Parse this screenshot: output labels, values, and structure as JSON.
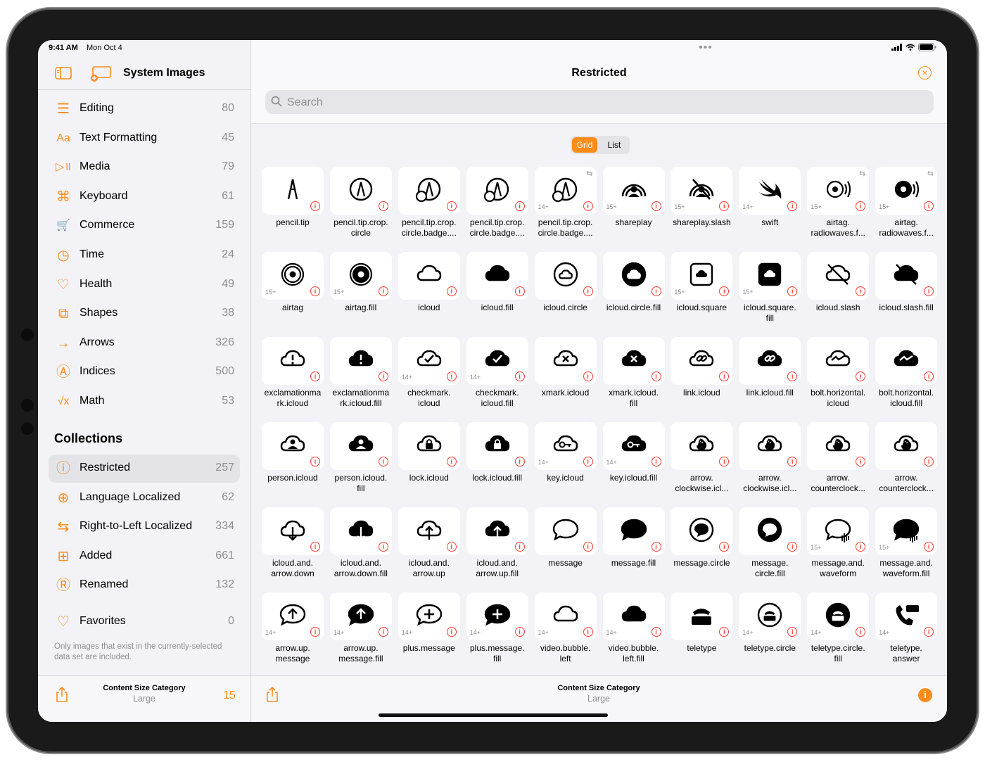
{
  "status": {
    "time": "9:41 AM",
    "date": "Mon Oct 4"
  },
  "sidebar": {
    "title": "System Images",
    "categories": [
      {
        "label": "Editing",
        "count": "80",
        "icon": "sliders-icon"
      },
      {
        "label": "Text Formatting",
        "count": "45",
        "icon": "textformat-icon"
      },
      {
        "label": "Media",
        "count": "79",
        "icon": "play-pause-icon"
      },
      {
        "label": "Keyboard",
        "count": "61",
        "icon": "command-icon"
      },
      {
        "label": "Commerce",
        "count": "159",
        "icon": "cart-icon"
      },
      {
        "label": "Time",
        "count": "24",
        "icon": "timer-icon"
      },
      {
        "label": "Health",
        "count": "49",
        "icon": "heart-icon"
      },
      {
        "label": "Shapes",
        "count": "38",
        "icon": "shapes-icon"
      },
      {
        "label": "Arrows",
        "count": "326",
        "icon": "arrow-right-icon"
      },
      {
        "label": "Indices",
        "count": "500",
        "icon": "a-circle-icon"
      },
      {
        "label": "Math",
        "count": "53",
        "icon": "function-icon"
      }
    ],
    "collections_heading": "Collections",
    "collections": [
      {
        "label": "Restricted",
        "count": "257",
        "icon": "info-circle-icon",
        "selected": true
      },
      {
        "label": "Language Localized",
        "count": "62",
        "icon": "globe-icon"
      },
      {
        "label": "Right-to-Left Localized",
        "count": "334",
        "icon": "arrow-left-right-icon"
      },
      {
        "label": "Added",
        "count": "661",
        "icon": "plus-square-icon"
      },
      {
        "label": "Renamed",
        "count": "132",
        "icon": "r-square-icon"
      }
    ],
    "favorites": {
      "label": "Favorites",
      "count": "0",
      "icon": "heart-icon"
    },
    "footnote": "Only images that exist in the currently-selected data set are included.",
    "bottom": {
      "label": "Content Size Category",
      "value": "Large",
      "count": "15"
    }
  },
  "main": {
    "title": "Restricted",
    "search_placeholder": "Search",
    "segments": {
      "grid": "Grid",
      "list": "List",
      "selected": "Grid"
    },
    "bottom": {
      "label": "Content Size Category",
      "value": "Large"
    },
    "accent": "#ff8c1a",
    "info_color": "#ff3b30",
    "symbols": [
      {
        "name": "pencil.tip",
        "ver": "",
        "rtl": false
      },
      {
        "name": "pencil.tip.crop.\ncircle",
        "ver": "",
        "rtl": false
      },
      {
        "name": "pencil.tip.crop.\ncircle.badge....",
        "ver": "",
        "rtl": false
      },
      {
        "name": "pencil.tip.crop.\ncircle.badge....",
        "ver": "",
        "rtl": false
      },
      {
        "name": "pencil.tip.crop.\ncircle.badge....",
        "ver": "14+",
        "rtl": true
      },
      {
        "name": "shareplay",
        "ver": "15+",
        "rtl": false
      },
      {
        "name": "shareplay.slash",
        "ver": "15+",
        "rtl": false
      },
      {
        "name": "swift",
        "ver": "14+",
        "rtl": false
      },
      {
        "name": "airtag.\nradiowaves.f...",
        "ver": "15+",
        "rtl": true
      },
      {
        "name": "airtag.\nradiowaves.f...",
        "ver": "15+",
        "rtl": true
      },
      {
        "name": "airtag",
        "ver": "15+",
        "rtl": false
      },
      {
        "name": "airtag.fill",
        "ver": "15+",
        "rtl": false
      },
      {
        "name": "icloud",
        "ver": "",
        "rtl": false
      },
      {
        "name": "icloud.fill",
        "ver": "",
        "rtl": false
      },
      {
        "name": "icloud.circle",
        "ver": "",
        "rtl": false
      },
      {
        "name": "icloud.circle.fill",
        "ver": "",
        "rtl": false
      },
      {
        "name": "icloud.square",
        "ver": "15+",
        "rtl": false
      },
      {
        "name": "icloud.square.\nfill",
        "ver": "15+",
        "rtl": false
      },
      {
        "name": "icloud.slash",
        "ver": "",
        "rtl": false
      },
      {
        "name": "icloud.slash.fill",
        "ver": "",
        "rtl": false
      },
      {
        "name": "exclamationma\nrk.icloud",
        "ver": "",
        "rtl": false
      },
      {
        "name": "exclamationma\nrk.icloud.fill",
        "ver": "",
        "rtl": false
      },
      {
        "name": "checkmark.\nicloud",
        "ver": "14+",
        "rtl": false
      },
      {
        "name": "checkmark.\nicloud.fill",
        "ver": "14+",
        "rtl": false
      },
      {
        "name": "xmark.icloud",
        "ver": "",
        "rtl": false
      },
      {
        "name": "xmark.icloud.\nfill",
        "ver": "",
        "rtl": false
      },
      {
        "name": "link.icloud",
        "ver": "",
        "rtl": false
      },
      {
        "name": "link.icloud.fill",
        "ver": "",
        "rtl": false
      },
      {
        "name": "bolt.horizontal.\nicloud",
        "ver": "",
        "rtl": false
      },
      {
        "name": "bolt.horizontal.\nicloud.fill",
        "ver": "",
        "rtl": false
      },
      {
        "name": "person.icloud",
        "ver": "",
        "rtl": false
      },
      {
        "name": "person.icloud.\nfill",
        "ver": "",
        "rtl": false
      },
      {
        "name": "lock.icloud",
        "ver": "",
        "rtl": false
      },
      {
        "name": "lock.icloud.fill",
        "ver": "",
        "rtl": false
      },
      {
        "name": "key.icloud",
        "ver": "14+",
        "rtl": false
      },
      {
        "name": "key.icloud.fill",
        "ver": "14+",
        "rtl": false
      },
      {
        "name": "arrow.\nclockwise.icl...",
        "ver": "",
        "rtl": false
      },
      {
        "name": "arrow.\nclockwise.icl...",
        "ver": "",
        "rtl": false
      },
      {
        "name": "arrow.\ncounterclock...",
        "ver": "",
        "rtl": false
      },
      {
        "name": "arrow.\ncounterclock...",
        "ver": "",
        "rtl": false
      },
      {
        "name": "icloud.and.\narrow.down",
        "ver": "",
        "rtl": false
      },
      {
        "name": "icloud.and.\narrow.down.fill",
        "ver": "",
        "rtl": false
      },
      {
        "name": "icloud.and.\narrow.up",
        "ver": "",
        "rtl": false
      },
      {
        "name": "icloud.and.\narrow.up.fill",
        "ver": "",
        "rtl": false
      },
      {
        "name": "message",
        "ver": "",
        "rtl": false
      },
      {
        "name": "message.fill",
        "ver": "",
        "rtl": false
      },
      {
        "name": "message.circle",
        "ver": "",
        "rtl": false
      },
      {
        "name": "message.\ncircle.fill",
        "ver": "",
        "rtl": false
      },
      {
        "name": "message.and.\nwaveform",
        "ver": "15+",
        "rtl": false
      },
      {
        "name": "message.and.\nwaveform.fill",
        "ver": "15+",
        "rtl": false
      },
      {
        "name": "arrow.up.\nmessage",
        "ver": "14+",
        "rtl": false
      },
      {
        "name": "arrow.up.\nmessage.fill",
        "ver": "14+",
        "rtl": false
      },
      {
        "name": "plus.message",
        "ver": "14+",
        "rtl": false
      },
      {
        "name": "plus.message.\nfill",
        "ver": "14+",
        "rtl": false
      },
      {
        "name": "video.bubble.\nleft",
        "ver": "14+",
        "rtl": false
      },
      {
        "name": "video.bubble.\nleft.fill",
        "ver": "14+",
        "rtl": false
      },
      {
        "name": "teletype",
        "ver": "",
        "rtl": false
      },
      {
        "name": "teletype.circle",
        "ver": "14+",
        "rtl": false
      },
      {
        "name": "teletype.circle.\nfill",
        "ver": "14+",
        "rtl": false
      },
      {
        "name": "teletype.\nanswer",
        "ver": "14+",
        "rtl": false
      }
    ]
  }
}
